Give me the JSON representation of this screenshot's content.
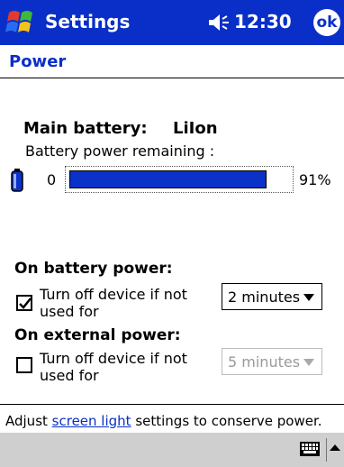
{
  "window": {
    "title": "Settings",
    "clock": "12:30",
    "ok_label": "ok"
  },
  "page": {
    "title": "Power"
  },
  "battery": {
    "main_label": "Main battery:",
    "type": "LiIon",
    "remaining_label": "Battery power remaining :",
    "min_label": "0",
    "percent_label": "91%",
    "level": 0.91
  },
  "on_battery": {
    "label": "On battery power:",
    "checkbox_text": "Turn off device if not used for",
    "checked": true,
    "dropdown_value": "2 minutes",
    "enabled": true
  },
  "on_external": {
    "label": "On external power:",
    "checkbox_text": "Turn off device if not used for",
    "checked": false,
    "dropdown_value": "5 minutes",
    "enabled": false
  },
  "footer": {
    "prefix": "Adjust ",
    "link": "screen light",
    "suffix": " settings to conserve power."
  },
  "colors": {
    "titlebar": "#0a2fc8",
    "accent": "#0a2fc8",
    "progress": "#0a32c8",
    "bottom_bar": "#cfcfcf"
  },
  "icons": [
    "windows-start-icon",
    "volume-icon",
    "battery-icon",
    "checkmark-icon",
    "dropdown-arrow-icon",
    "keyboard-icon",
    "sip-up-arrow-icon"
  ]
}
